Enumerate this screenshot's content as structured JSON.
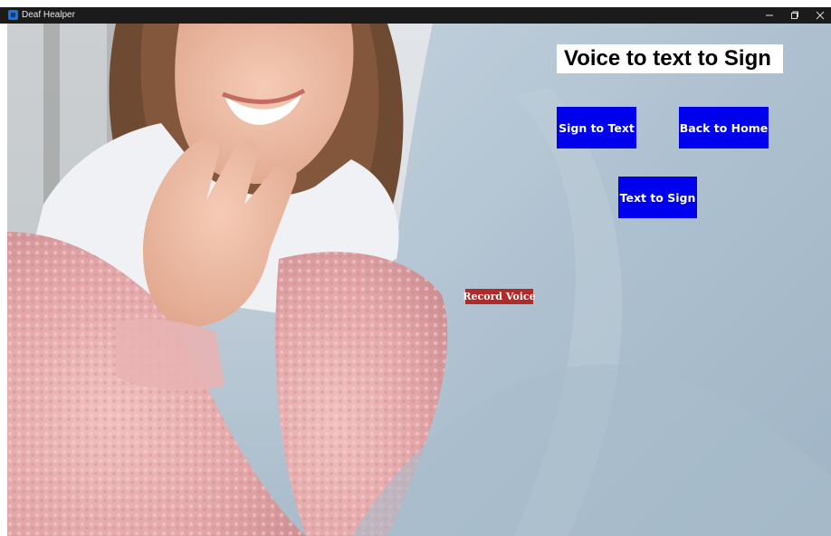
{
  "window": {
    "title": "Deaf Healper",
    "icon": "app-icon",
    "controls": [
      "minimize-icon",
      "restore-icon",
      "close-icon"
    ]
  },
  "main": {
    "heading": "Voice to text to Sign",
    "buttons": {
      "sign_to_text": "Sign to Text",
      "back_to_home": "Back to Home",
      "text_to_sign": "Text to Sign",
      "record_voice": "Record Voice"
    }
  },
  "colors": {
    "nav_button": "#0000EE",
    "record_button": "#B02A2A",
    "heading_background": "#FFFFFF",
    "titlebar": "#1B1B1B"
  }
}
